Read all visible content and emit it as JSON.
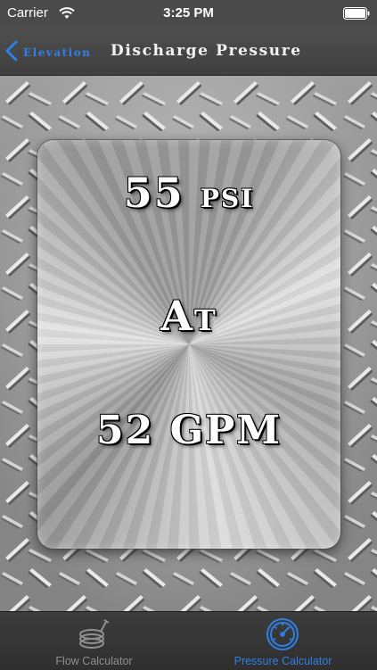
{
  "status_bar": {
    "carrier": "Carrier",
    "time": "3:25 PM"
  },
  "nav": {
    "back_label": "Elevation",
    "title": "Discharge Pressure",
    "accent_color": "#2f7fe6"
  },
  "result": {
    "pressure_value": "55",
    "pressure_unit": "psi",
    "connector": "At",
    "flow_text": "52 GPM"
  },
  "tab_bar": {
    "tabs": [
      {
        "label": "Flow Calculator",
        "icon": "hose-reel-icon",
        "selected": false
      },
      {
        "label": "Pressure Calculator",
        "icon": "pressure-gauge-icon",
        "selected": true
      }
    ],
    "selected_color": "#2f7fe6",
    "unselected_color": "#8f8f8f"
  }
}
